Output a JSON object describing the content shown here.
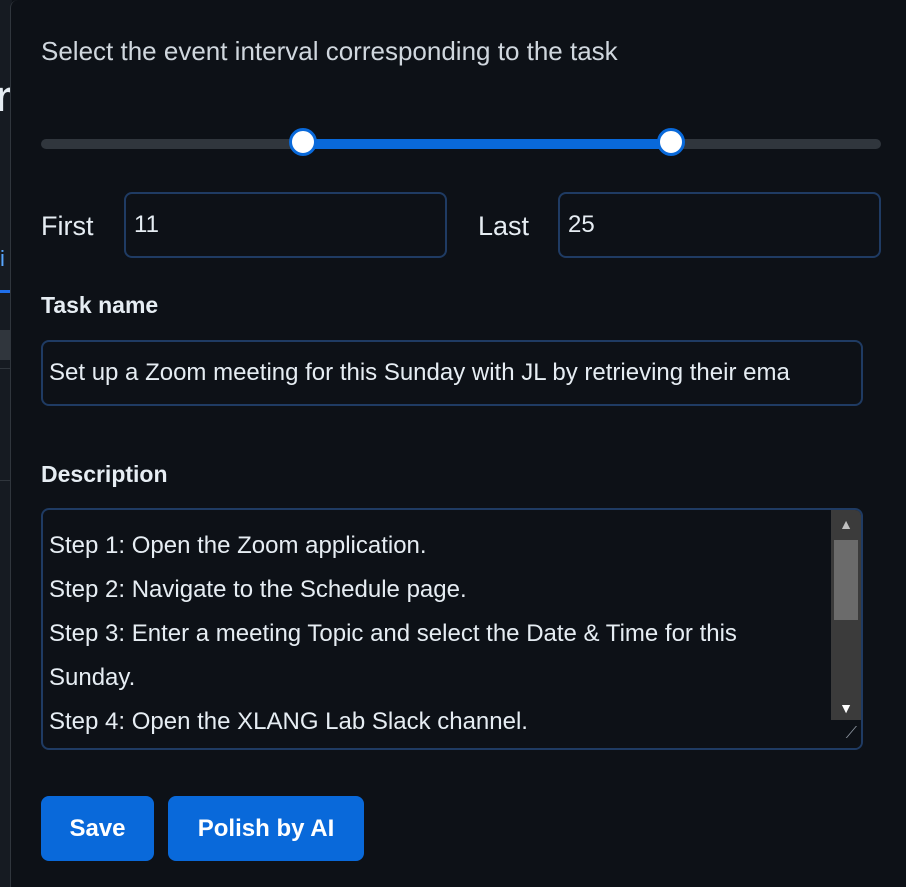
{
  "background": {
    "letter": "n",
    "tab_fragment": "i"
  },
  "dialog": {
    "heading": "Select the event interval corresponding to the task",
    "interval": {
      "first_label": "First",
      "first_value": "11",
      "last_label": "Last",
      "last_value": "25",
      "slider_low_fraction": 0.312,
      "slider_high_fraction": 0.75
    },
    "task_name": {
      "label": "Task name",
      "value": "Set up a Zoom meeting for this Sunday with JL by retrieving their ema"
    },
    "description": {
      "label": "Description",
      "lines": [
        "Step 1: Open the Zoom application.",
        "Step 2: Navigate to the Schedule page.",
        "Step 3: Enter a meeting Topic and select the Date & Time for this",
        "Sunday.",
        "Step 4: Open the XLANG Lab Slack channel."
      ]
    },
    "buttons": {
      "save": "Save",
      "polish": "Polish by AI"
    }
  },
  "colors": {
    "accent": "#0969da",
    "background": "#0d1117",
    "input_border": "#1f3b63",
    "text": "#e6edf3"
  },
  "icons": {
    "scroll_up": "▲",
    "scroll_down": "▼",
    "resize": "⟋"
  }
}
